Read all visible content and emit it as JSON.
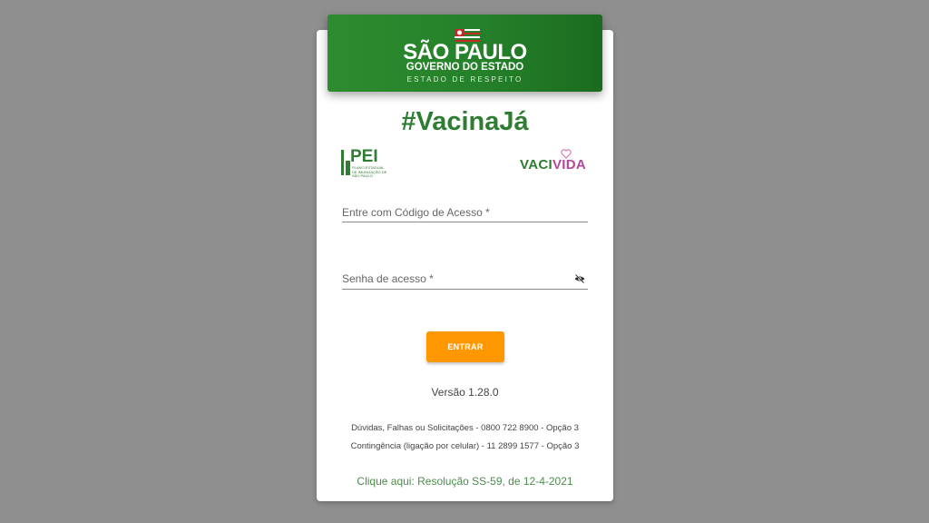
{
  "header": {
    "state_name": "SÃO PAULO",
    "government": "GOVERNO DO ESTADO",
    "slogan": "ESTADO DE RESPEITO"
  },
  "title": "#VacinaJá",
  "logos": {
    "pei": {
      "name": "PEI",
      "subtitle": "PLANO ESTADUAL DE IMUNIZAÇÃO DE SÃO PAULO"
    },
    "vacivida": {
      "vaci": "VACI",
      "vida": "VIDA"
    }
  },
  "form": {
    "access_code_label": "Entre com Código de Acesso *",
    "password_label": "Senha de acesso *",
    "submit_label": "ENTRAR"
  },
  "version": "Versão 1.28.0",
  "contacts": {
    "support": "Dúvidas, Falhas ou Solicitações - 0800 722 8900 - Opção 3",
    "contingency": "Contingência (ligação por celular) - 11 2899 1577 - Opção 3"
  },
  "resolution_link": "Clique aqui: Resolução SS-59, de 12-4-2021",
  "colors": {
    "brand_green": "#2e7d32",
    "button_orange": "#ff9800",
    "vida_magenta": "#b5479b",
    "background": "#8f8f8f"
  }
}
